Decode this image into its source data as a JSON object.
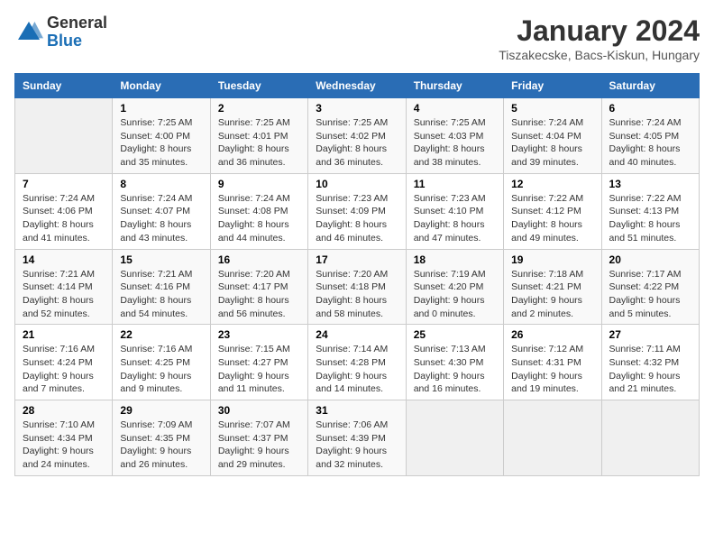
{
  "logo": {
    "general": "General",
    "blue": "Blue"
  },
  "title": "January 2024",
  "subtitle": "Tiszakecske, Bacs-Kiskun, Hungary",
  "days_header": [
    "Sunday",
    "Monday",
    "Tuesday",
    "Wednesday",
    "Thursday",
    "Friday",
    "Saturday"
  ],
  "weeks": [
    [
      {
        "day": "",
        "info": ""
      },
      {
        "day": "1",
        "info": "Sunrise: 7:25 AM\nSunset: 4:00 PM\nDaylight: 8 hours\nand 35 minutes."
      },
      {
        "day": "2",
        "info": "Sunrise: 7:25 AM\nSunset: 4:01 PM\nDaylight: 8 hours\nand 36 minutes."
      },
      {
        "day": "3",
        "info": "Sunrise: 7:25 AM\nSunset: 4:02 PM\nDaylight: 8 hours\nand 36 minutes."
      },
      {
        "day": "4",
        "info": "Sunrise: 7:25 AM\nSunset: 4:03 PM\nDaylight: 8 hours\nand 38 minutes."
      },
      {
        "day": "5",
        "info": "Sunrise: 7:24 AM\nSunset: 4:04 PM\nDaylight: 8 hours\nand 39 minutes."
      },
      {
        "day": "6",
        "info": "Sunrise: 7:24 AM\nSunset: 4:05 PM\nDaylight: 8 hours\nand 40 minutes."
      }
    ],
    [
      {
        "day": "7",
        "info": "Sunrise: 7:24 AM\nSunset: 4:06 PM\nDaylight: 8 hours\nand 41 minutes."
      },
      {
        "day": "8",
        "info": "Sunrise: 7:24 AM\nSunset: 4:07 PM\nDaylight: 8 hours\nand 43 minutes."
      },
      {
        "day": "9",
        "info": "Sunrise: 7:24 AM\nSunset: 4:08 PM\nDaylight: 8 hours\nand 44 minutes."
      },
      {
        "day": "10",
        "info": "Sunrise: 7:23 AM\nSunset: 4:09 PM\nDaylight: 8 hours\nand 46 minutes."
      },
      {
        "day": "11",
        "info": "Sunrise: 7:23 AM\nSunset: 4:10 PM\nDaylight: 8 hours\nand 47 minutes."
      },
      {
        "day": "12",
        "info": "Sunrise: 7:22 AM\nSunset: 4:12 PM\nDaylight: 8 hours\nand 49 minutes."
      },
      {
        "day": "13",
        "info": "Sunrise: 7:22 AM\nSunset: 4:13 PM\nDaylight: 8 hours\nand 51 minutes."
      }
    ],
    [
      {
        "day": "14",
        "info": "Sunrise: 7:21 AM\nSunset: 4:14 PM\nDaylight: 8 hours\nand 52 minutes."
      },
      {
        "day": "15",
        "info": "Sunrise: 7:21 AM\nSunset: 4:16 PM\nDaylight: 8 hours\nand 54 minutes."
      },
      {
        "day": "16",
        "info": "Sunrise: 7:20 AM\nSunset: 4:17 PM\nDaylight: 8 hours\nand 56 minutes."
      },
      {
        "day": "17",
        "info": "Sunrise: 7:20 AM\nSunset: 4:18 PM\nDaylight: 8 hours\nand 58 minutes."
      },
      {
        "day": "18",
        "info": "Sunrise: 7:19 AM\nSunset: 4:20 PM\nDaylight: 9 hours\nand 0 minutes."
      },
      {
        "day": "19",
        "info": "Sunrise: 7:18 AM\nSunset: 4:21 PM\nDaylight: 9 hours\nand 2 minutes."
      },
      {
        "day": "20",
        "info": "Sunrise: 7:17 AM\nSunset: 4:22 PM\nDaylight: 9 hours\nand 5 minutes."
      }
    ],
    [
      {
        "day": "21",
        "info": "Sunrise: 7:16 AM\nSunset: 4:24 PM\nDaylight: 9 hours\nand 7 minutes."
      },
      {
        "day": "22",
        "info": "Sunrise: 7:16 AM\nSunset: 4:25 PM\nDaylight: 9 hours\nand 9 minutes."
      },
      {
        "day": "23",
        "info": "Sunrise: 7:15 AM\nSunset: 4:27 PM\nDaylight: 9 hours\nand 11 minutes."
      },
      {
        "day": "24",
        "info": "Sunrise: 7:14 AM\nSunset: 4:28 PM\nDaylight: 9 hours\nand 14 minutes."
      },
      {
        "day": "25",
        "info": "Sunrise: 7:13 AM\nSunset: 4:30 PM\nDaylight: 9 hours\nand 16 minutes."
      },
      {
        "day": "26",
        "info": "Sunrise: 7:12 AM\nSunset: 4:31 PM\nDaylight: 9 hours\nand 19 minutes."
      },
      {
        "day": "27",
        "info": "Sunrise: 7:11 AM\nSunset: 4:32 PM\nDaylight: 9 hours\nand 21 minutes."
      }
    ],
    [
      {
        "day": "28",
        "info": "Sunrise: 7:10 AM\nSunset: 4:34 PM\nDaylight: 9 hours\nand 24 minutes."
      },
      {
        "day": "29",
        "info": "Sunrise: 7:09 AM\nSunset: 4:35 PM\nDaylight: 9 hours\nand 26 minutes."
      },
      {
        "day": "30",
        "info": "Sunrise: 7:07 AM\nSunset: 4:37 PM\nDaylight: 9 hours\nand 29 minutes."
      },
      {
        "day": "31",
        "info": "Sunrise: 7:06 AM\nSunset: 4:39 PM\nDaylight: 9 hours\nand 32 minutes."
      },
      {
        "day": "",
        "info": ""
      },
      {
        "day": "",
        "info": ""
      },
      {
        "day": "",
        "info": ""
      }
    ]
  ]
}
